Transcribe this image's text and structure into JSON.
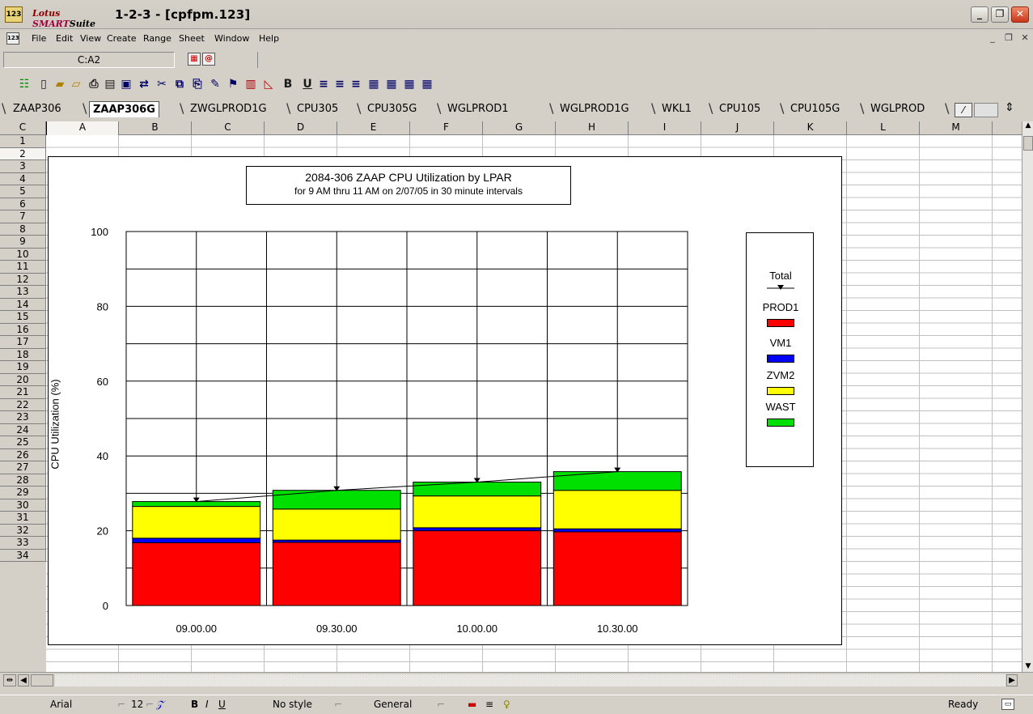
{
  "window": {
    "app_icon": "123",
    "brand_lotus": "Lotus",
    "brand_smart": "SMART",
    "brand_suite": "Suite",
    "title": "1-2-3 - [cpfpm.123]",
    "minimize": "_",
    "restore": "❐",
    "close": "✕"
  },
  "menu": {
    "items": [
      "File",
      "Edit",
      "View",
      "Create",
      "Range",
      "Sheet",
      "Window",
      "Help"
    ],
    "mdi_minimize": "_",
    "mdi_restore": "❐",
    "mdi_close": "✕"
  },
  "formula_bar": {
    "name_box": "C:A2",
    "contents": ""
  },
  "toolbar": {
    "icons": [
      "smarticon-person-icon",
      "new-file-icon",
      "open-file-icon",
      "open-folder-icon",
      "print-preview-icon",
      "print-icon",
      "screen-show-icon",
      "undo-icon",
      "cut-icon",
      "copy-icon",
      "paste-icon",
      "format-painter-icon",
      "chart-icon",
      "draw-icon",
      "bold-icon",
      "underline-icon",
      "align-left-icon",
      "align-center-icon",
      "align-right-icon",
      "grid-1-icon",
      "grid-2-icon",
      "grid-3-icon",
      "grid-4-icon"
    ],
    "bold": "B",
    "underline": "U"
  },
  "sheet_tabs": {
    "tabs": [
      "ZAAP306",
      "ZAAP306G",
      "ZWGLPROD1G",
      "CPU305",
      "CPU305G",
      "WGLPROD1",
      "WGLPROD1G",
      "WKL1",
      "CPU105",
      "CPU105G",
      "WGLPROD"
    ],
    "active": "ZAAP306G"
  },
  "grid": {
    "corner": "C",
    "columns": [
      "A",
      "B",
      "C",
      "D",
      "E",
      "F",
      "G",
      "H",
      "I",
      "J",
      "K",
      "L",
      "M"
    ],
    "rows": [
      "1",
      "2",
      "3",
      "4",
      "5",
      "6",
      "7",
      "8",
      "9",
      "10",
      "11",
      "12",
      "13",
      "14",
      "15",
      "16",
      "17",
      "18",
      "19",
      "20",
      "21",
      "22",
      "23",
      "24",
      "25",
      "26",
      "27",
      "28",
      "29",
      "30",
      "31",
      "32",
      "33",
      "34"
    ]
  },
  "chart_data": {
    "type": "bar",
    "stacked": true,
    "title": "2084-306 ZAAP CPU Utilization by LPAR",
    "subtitle": "for 9 AM thru 11 AM on 2/07/05 in 30 minute intervals",
    "xlabel": "",
    "ylabel": "CPU Utilization (%)",
    "ylim": [
      0,
      100
    ],
    "yticks": [
      0,
      20,
      40,
      60,
      80,
      100
    ],
    "grid": true,
    "legend_position": "right",
    "categories": [
      "09.00.00",
      "09.30.00",
      "10.00.00",
      "10.30.00"
    ],
    "series": [
      {
        "name": "PROD1",
        "color": "#ff0000",
        "values": [
          16.8,
          16.9,
          20.0,
          19.7
        ]
      },
      {
        "name": "VM1",
        "color": "#0000ff",
        "values": [
          1.2,
          0.6,
          0.8,
          0.8
        ]
      },
      {
        "name": "ZVM2",
        "color": "#ffff00",
        "values": [
          8.5,
          8.3,
          8.5,
          10.3
        ]
      },
      {
        "name": "WAST",
        "color": "#00e000",
        "values": [
          1.3,
          5.0,
          3.7,
          5.0
        ]
      }
    ],
    "total": {
      "name": "Total",
      "values": [
        27.8,
        30.8,
        33.0,
        35.8
      ]
    }
  },
  "status_bar": {
    "font": "Arial",
    "size": "12",
    "bold": "B",
    "italic": "I",
    "underline": "U",
    "style": "No style",
    "format": "General",
    "mode": "Ready"
  }
}
